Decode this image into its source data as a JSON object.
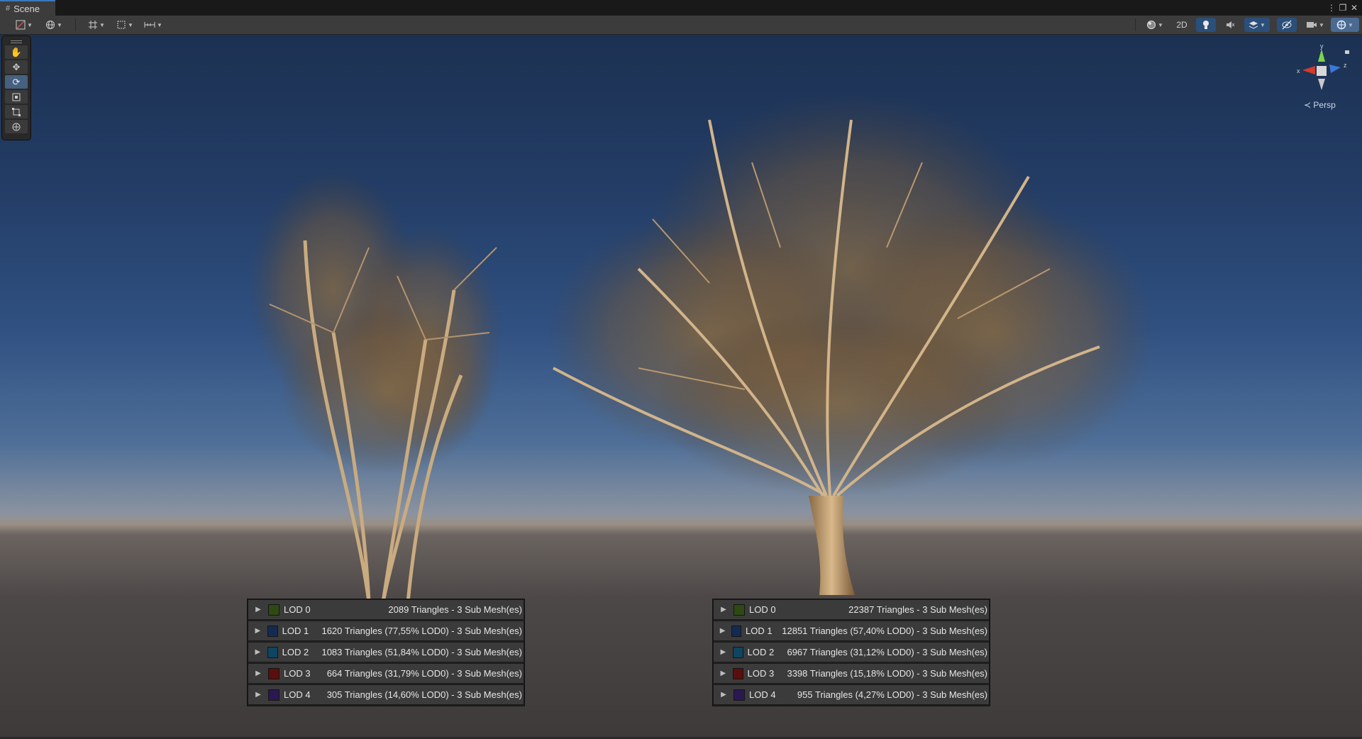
{
  "window": {
    "tab_title": "Scene",
    "tab_icon": "grid-icon"
  },
  "toolbar": {
    "btn_2d": "2D"
  },
  "viewport": {
    "projection": "Persp",
    "axis_x": "x",
    "axis_y": "y",
    "axis_z": "z"
  },
  "colors": {
    "lod0": "#2e4a12",
    "lod1": "#142a52",
    "lod2": "#0e4560",
    "lod3": "#5a0e0e",
    "lod4": "#2a1850"
  },
  "lod_groups": [
    {
      "rows": [
        {
          "label": "LOD 0",
          "info": "2089 Triangles  - 3 Sub Mesh(es)",
          "color": "#2e4a12"
        },
        {
          "label": "LOD 1",
          "info": "1620 Triangles (77,55% LOD0) - 3 Sub Mesh(es)",
          "color": "#142a52"
        },
        {
          "label": "LOD 2",
          "info": "1083 Triangles (51,84% LOD0) - 3 Sub Mesh(es)",
          "color": "#0e4560"
        },
        {
          "label": "LOD 3",
          "info": "664 Triangles (31,79% LOD0) - 3 Sub Mesh(es)",
          "color": "#5a0e0e"
        },
        {
          "label": "LOD 4",
          "info": "305 Triangles (14,60% LOD0) - 3 Sub Mesh(es)",
          "color": "#2a1850"
        }
      ]
    },
    {
      "rows": [
        {
          "label": "LOD 0",
          "info": "22387 Triangles  - 3 Sub Mesh(es)",
          "color": "#2e4a12"
        },
        {
          "label": "LOD 1",
          "info": "12851 Triangles (57,40% LOD0) - 3 Sub Mesh(es)",
          "color": "#142a52"
        },
        {
          "label": "LOD 2",
          "info": "6967 Triangles (31,12% LOD0) - 3 Sub Mesh(es)",
          "color": "#0e4560"
        },
        {
          "label": "LOD 3",
          "info": "3398 Triangles (15,18% LOD0) - 3 Sub Mesh(es)",
          "color": "#5a0e0e"
        },
        {
          "label": "LOD 4",
          "info": "955 Triangles (4,27% LOD0) - 3 Sub Mesh(es)",
          "color": "#2a1850"
        }
      ]
    }
  ]
}
